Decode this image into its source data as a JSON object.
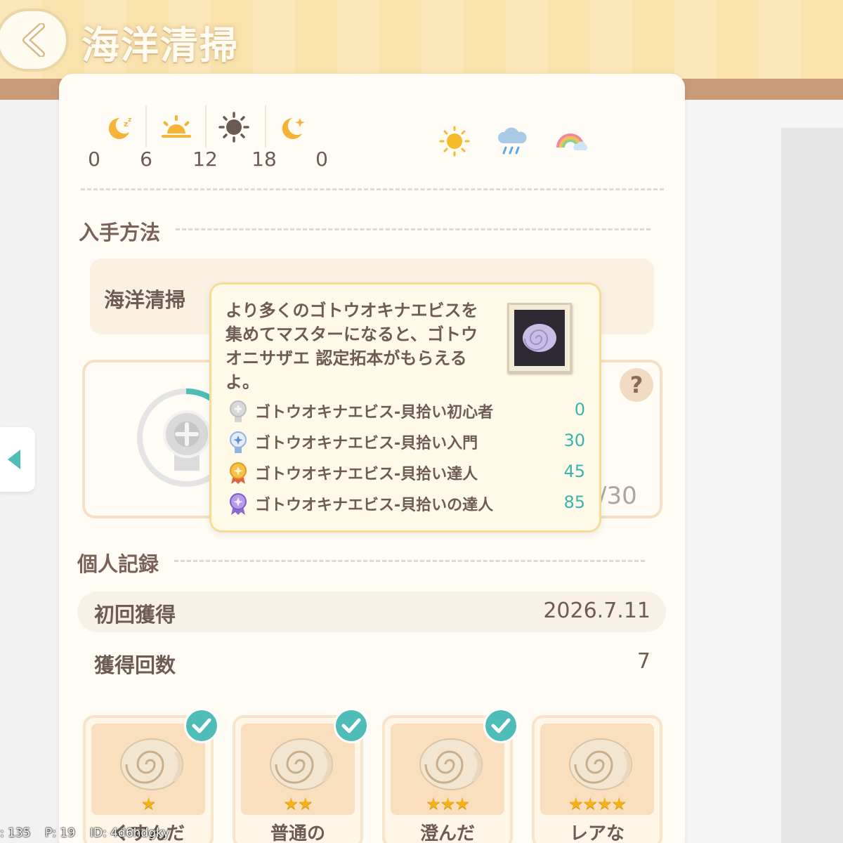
{
  "header": {
    "title": "海洋清掃",
    "back_icon": "chevron-left-icon"
  },
  "time": {
    "icons": [
      "sleep-moon-icon",
      "sunrise-icon",
      "sun-icon",
      "moon-star-icon"
    ],
    "labels": [
      "0",
      "6",
      "12",
      "18",
      "0"
    ]
  },
  "weather": {
    "icons": [
      "sunny-icon",
      "rain-icon",
      "rainbow-icon"
    ]
  },
  "acquisition": {
    "title": "入手方法",
    "method": "海洋清掃"
  },
  "mastery": {
    "help_label": "?",
    "progress_partial": "/30",
    "progress_fraction": 0.23
  },
  "tooltip": {
    "description": "より多くのゴトウオキナエビスを集めてマスターになると、ゴトウオニサザエ 認定拓本がもらえるよ。",
    "tiers": [
      {
        "name": "ゴトウオキナエビス-貝拾い初心者",
        "value": "0",
        "icon": "silver-medal-icon"
      },
      {
        "name": "ゴトウオキナエビス-貝拾い入門",
        "value": "30",
        "icon": "blue-medal-icon"
      },
      {
        "name": "ゴトウオキナエビス-貝拾い達人",
        "value": "45",
        "icon": "gold-medal-icon"
      },
      {
        "name": "ゴトウオキナエビス-貝拾いの達人",
        "value": "85",
        "icon": "purple-medal-icon"
      }
    ]
  },
  "records": {
    "title": "個人記録",
    "first_label": "初回獲得",
    "first_value": "2026.7.11",
    "count_label": "獲得回数",
    "count_value": "7"
  },
  "variants": [
    {
      "stars": "★",
      "label": "くすんだ",
      "checked": true
    },
    {
      "stars": "★★",
      "label": "普通の",
      "checked": true
    },
    {
      "stars": "★★★",
      "label": "澄んだ",
      "checked": true
    },
    {
      "stars": "★★★★",
      "label": "レアな",
      "checked": false
    }
  ],
  "debug": {
    "left": ": 135",
    "middle": "P: 19",
    "right": "ID: 4d6hdgky"
  },
  "colors": {
    "accent_teal": "#39b5ad",
    "header_yellow": "#f9e2ac",
    "card_bg": "#fffcf5"
  }
}
